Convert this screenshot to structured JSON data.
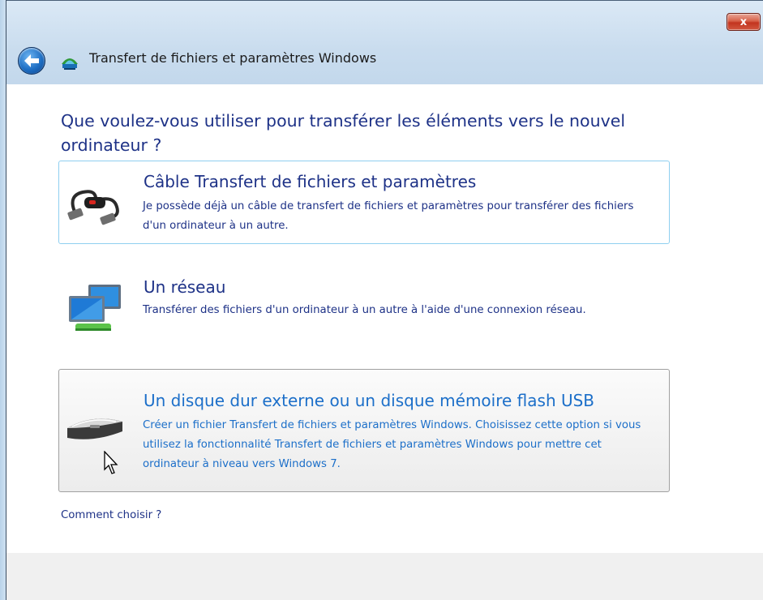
{
  "window": {
    "title": "Transfert de fichiers et paramètres Windows",
    "close_label": "x"
  },
  "question": "Que voulez-vous utiliser pour transférer les éléments vers le nouvel ordinateur ?",
  "options": [
    {
      "title": "Câble Transfert de fichiers et paramètres",
      "description": "Je possède déjà un câble de transfert de fichiers et paramètres pour transférer des fichiers d'un ordinateur à un autre.",
      "icon": "transfer-cable-icon",
      "state": "focused"
    },
    {
      "title": "Un réseau",
      "description": "Transférer des fichiers d'un ordinateur à un autre à l'aide d'une connexion réseau.",
      "icon": "network-icon",
      "state": "normal"
    },
    {
      "title": "Un disque dur externe ou un disque mémoire flash USB",
      "description": "Créer un fichier Transfert de fichiers et paramètres Windows. Choisissez cette option si vous utilisez la fonctionnalité Transfert de fichiers et paramètres Windows pour mettre cet ordinateur à niveau vers Windows 7.",
      "icon": "usb-drive-icon",
      "state": "hover"
    }
  ],
  "help_link": "Comment  choisir ?",
  "colors": {
    "link_blue": "#1e3287",
    "hover_blue": "#1c6fc9",
    "focus_border": "#8fcff0"
  }
}
